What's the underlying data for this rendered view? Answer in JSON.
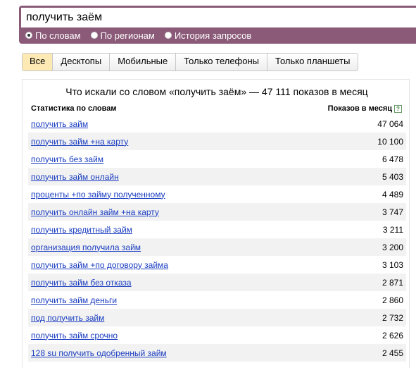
{
  "search": {
    "query": "получить заём"
  },
  "modes": [
    {
      "label": "По словам",
      "checked": true
    },
    {
      "label": "По регионам",
      "checked": false
    },
    {
      "label": "История запросов",
      "checked": false
    }
  ],
  "tabs": [
    {
      "label": "Все",
      "active": true
    },
    {
      "label": "Десктопы",
      "active": false
    },
    {
      "label": "Мобильные",
      "active": false
    },
    {
      "label": "Только телефоны",
      "active": false
    },
    {
      "label": "Только планшеты",
      "active": false
    }
  ],
  "stats": {
    "title": "Что искали со словом «получить заём» — 47 111 показов в месяц",
    "col_left": "Статистика по словам",
    "col_right": "Показов в месяц",
    "help_icon": "?",
    "rows": [
      {
        "phrase": "получить займ",
        "count": "47 064"
      },
      {
        "phrase": "получить займ +на карту",
        "count": "10 100"
      },
      {
        "phrase": "получить без займ",
        "count": "6 478"
      },
      {
        "phrase": "получить займ онлайн",
        "count": "5 403"
      },
      {
        "phrase": "проценты +по займу полученному",
        "count": "4 489"
      },
      {
        "phrase": "получить онлайн займ +на карту",
        "count": "3 747"
      },
      {
        "phrase": "получить кредитный займ",
        "count": "3 211"
      },
      {
        "phrase": "организация получила займ",
        "count": "3 200"
      },
      {
        "phrase": "получить займ +по договору займа",
        "count": "3 103"
      },
      {
        "phrase": "получить займ без отказа",
        "count": "2 871"
      },
      {
        "phrase": "получить займ деньги",
        "count": "2 860"
      },
      {
        "phrase": "под получить займ",
        "count": "2 732"
      },
      {
        "phrase": "получить займ срочно",
        "count": "2 626"
      },
      {
        "phrase": "128 su получить одобренный займ",
        "count": "2 455"
      }
    ]
  }
}
